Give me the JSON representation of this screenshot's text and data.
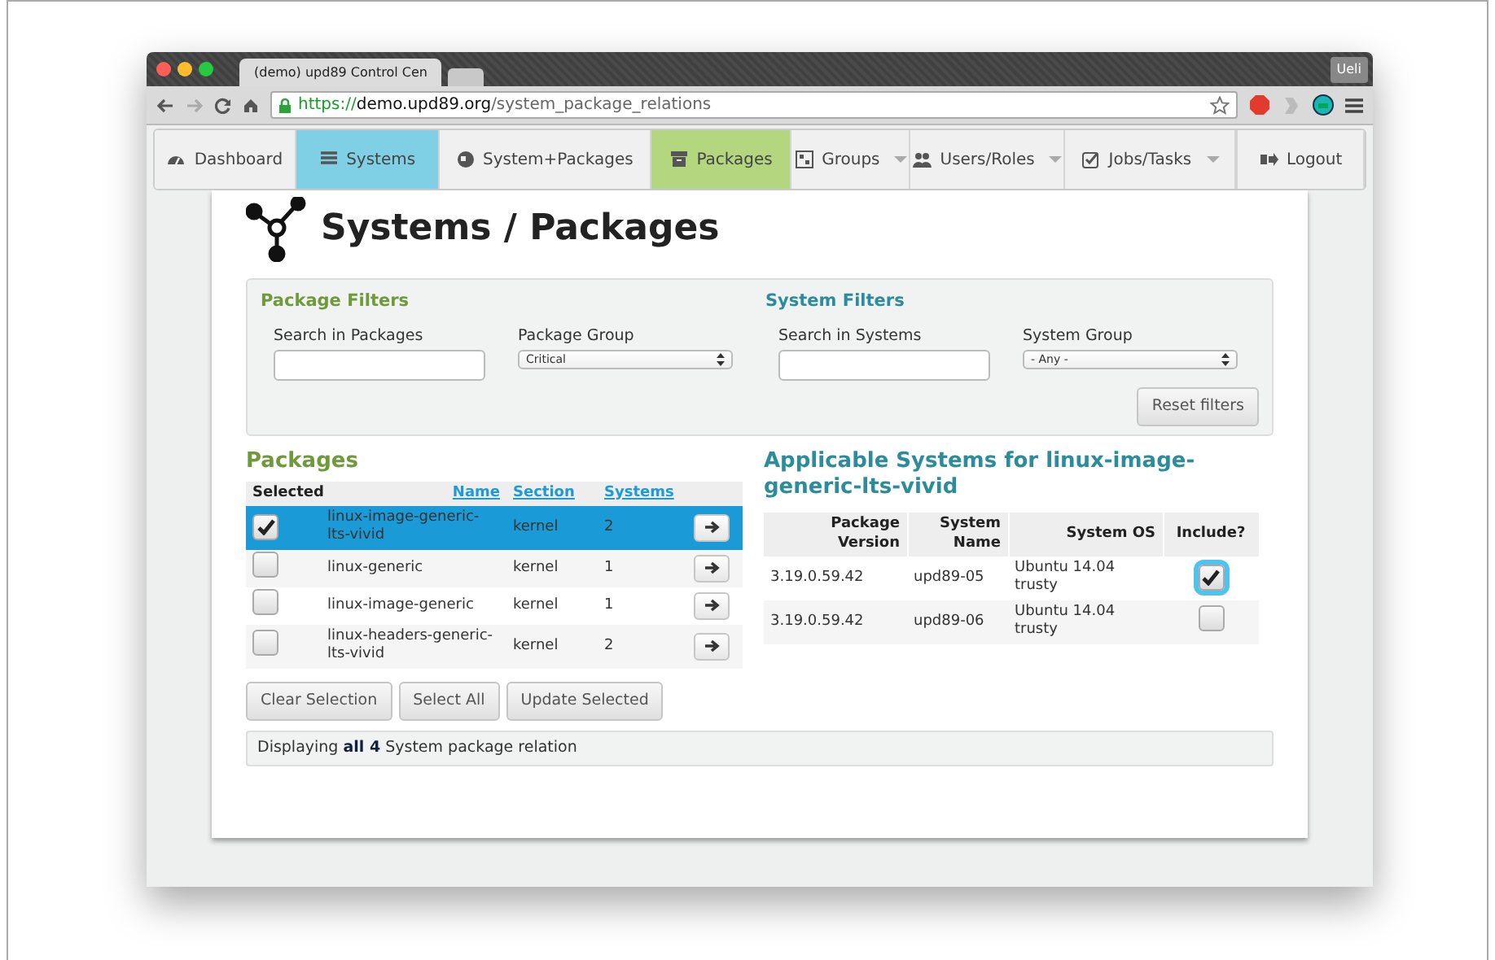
{
  "browser": {
    "tab_title": "(demo) upd89 Control Cen",
    "user": "Ueli",
    "url_scheme": "https://",
    "url_host": "demo.upd89.org",
    "url_path": "/system_package_relations"
  },
  "navbar": [
    {
      "label": "Dashboard",
      "color": "#f0f0f0",
      "dropdown": false
    },
    {
      "label": "Systems",
      "color": "#7fcfe5",
      "dropdown": false
    },
    {
      "label": "System+Packages",
      "color": "#f0f0f0",
      "dropdown": false
    },
    {
      "label": "Packages",
      "color": "#b3d67f",
      "dropdown": false
    },
    {
      "label": "Groups",
      "color": "#f0f0f0",
      "dropdown": true
    },
    {
      "label": "Users/Roles",
      "color": "#f0f0f0",
      "dropdown": true
    },
    {
      "label": "Jobs/Tasks",
      "color": "#f0f0f0",
      "dropdown": true
    },
    {
      "label": "Logout",
      "color": "#f0f0f0",
      "dropdown": false
    }
  ],
  "page_title": "Systems / Packages",
  "filters": [
    {
      "title": "Package Filters",
      "search_label": "Search in Packages",
      "group_label": "Package Group",
      "group_value": "Critical"
    },
    {
      "title": "System Filters",
      "search_label": "Search in Systems",
      "group_label": "System Group",
      "group_value": "- Any -"
    }
  ],
  "reset_button": "Reset filters",
  "packages": {
    "title": "Packages",
    "columns": [
      {
        "label": "Selected",
        "sortable": false
      },
      {
        "label": "Name",
        "sortable": true
      },
      {
        "label": "Section",
        "sortable": true
      },
      {
        "label": "Systems",
        "sortable": true
      }
    ],
    "rows": [
      {
        "selected": true,
        "name": "linux-image-generic-lts-vivid",
        "section": "kernel",
        "systems": "2"
      },
      {
        "selected": false,
        "name": "linux-generic",
        "section": "kernel",
        "systems": "1"
      },
      {
        "selected": false,
        "name": "linux-image-generic",
        "section": "kernel",
        "systems": "1"
      },
      {
        "selected": false,
        "name": "linux-headers-generic-lts-vivid",
        "section": "kernel",
        "systems": "2"
      }
    ],
    "buttons": [
      "Clear Selection",
      "Select All",
      "Update Selected"
    ],
    "footer": "Displaying **all 4** System package relation"
  },
  "systems": {
    "title": "Applicable Systems for linux-image-generic-lts-vivid",
    "columns": [
      "Package Version",
      "System Name",
      "System OS",
      "Include?"
    ],
    "rows": [
      {
        "version": "3.19.0.59.42",
        "name": "upd89-05",
        "os": "Ubuntu 14.04 trusty",
        "include": true,
        "focused": true
      },
      {
        "version": "3.19.0.59.42",
        "name": "upd89-06",
        "os": "Ubuntu 14.04 trusty",
        "include": false,
        "focused": false
      }
    ]
  }
}
